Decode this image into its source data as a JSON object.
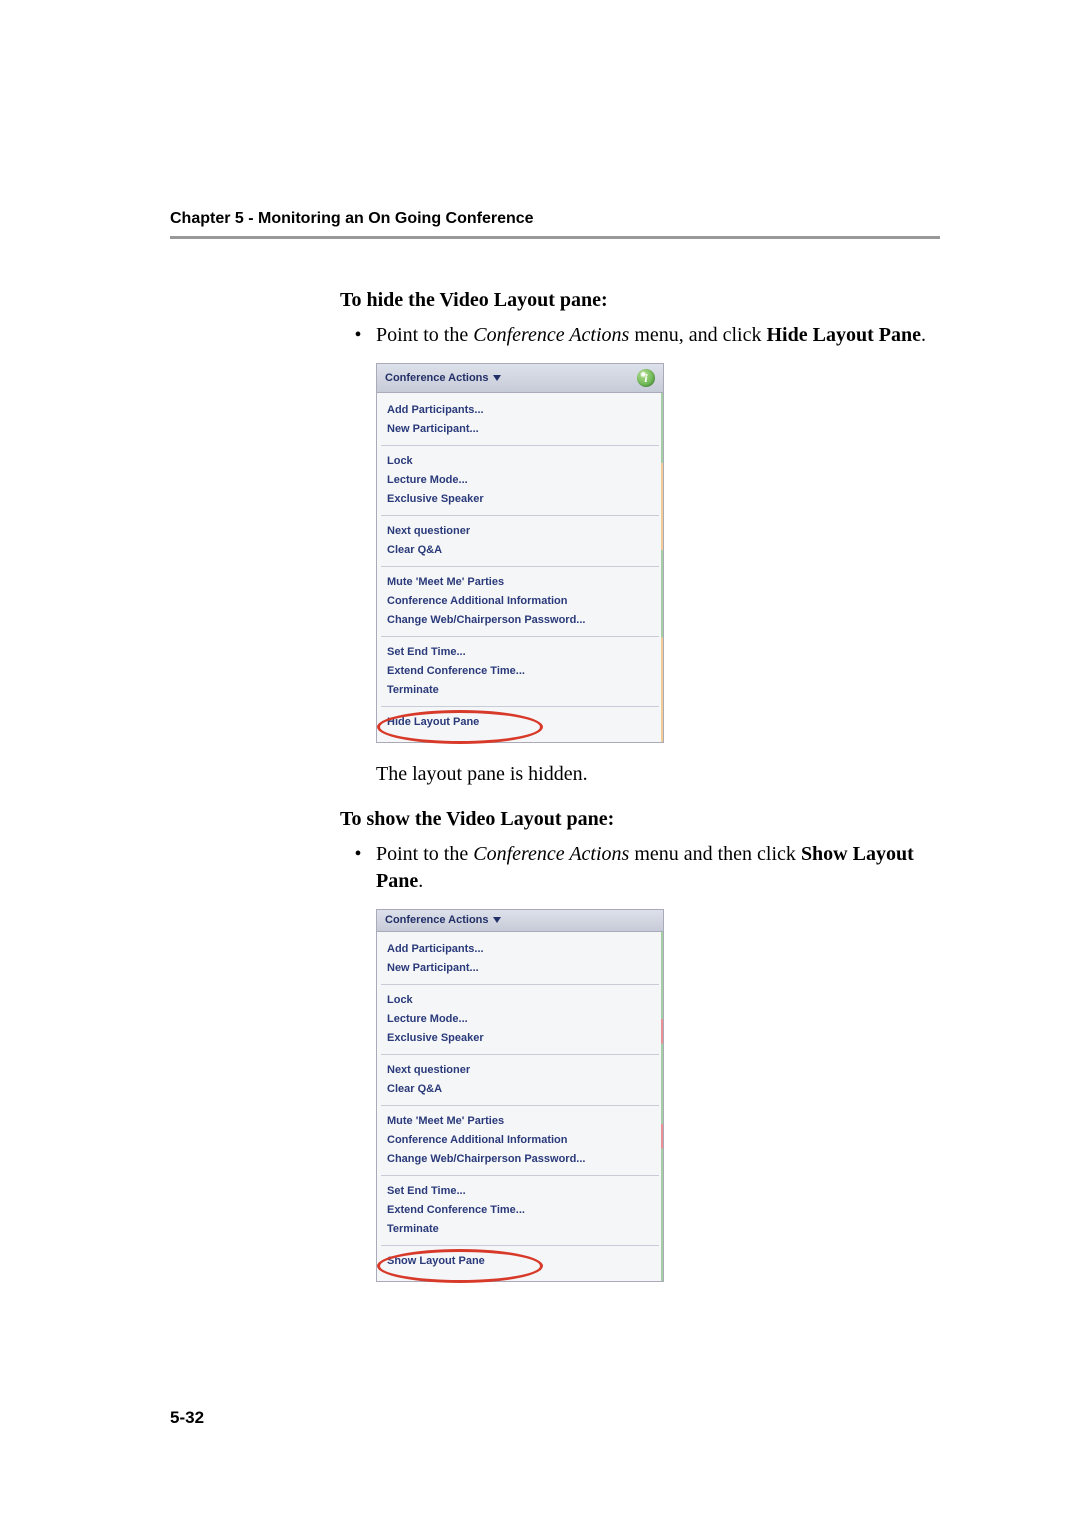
{
  "chapter": "Chapter 5 - Monitoring an On Going Conference",
  "section1": {
    "heading": "To hide the Video Layout pane:",
    "bullet_pre": "Point to the ",
    "bullet_em": "Conference Actions",
    "bullet_mid": " menu, and click ",
    "bullet_bold": "Hide Layout Pane",
    "bullet_post": ".",
    "result": "The layout pane is hidden."
  },
  "section2": {
    "heading": "To show the Video Layout pane:",
    "bullet_pre": "Point to the ",
    "bullet_em": "Conference Actions",
    "bullet_mid": " menu and then click ",
    "bullet_bold": "Show Layout Pane",
    "bullet_post": "."
  },
  "menu_header": "Conference Actions",
  "info_glyph": "i",
  "menu_items": {
    "add_participants": "Add Participants...",
    "new_participant": "New Participant...",
    "lock": "Lock",
    "lecture_mode": "Lecture Mode...",
    "exclusive_speaker": "Exclusive Speaker",
    "next_questioner": "Next questioner",
    "clear_qa": "Clear Q&A",
    "mute_meet_me": "Mute 'Meet Me' Parties",
    "conf_add_info": "Conference Additional Information",
    "change_pw": "Change Web/Chairperson Password...",
    "set_end_time": "Set End Time...",
    "extend_time": "Extend Conference Time...",
    "terminate": "Terminate",
    "hide_layout": "Hide Layout Pane",
    "show_layout": "Show Layout Pane"
  },
  "page_number": "5-32"
}
